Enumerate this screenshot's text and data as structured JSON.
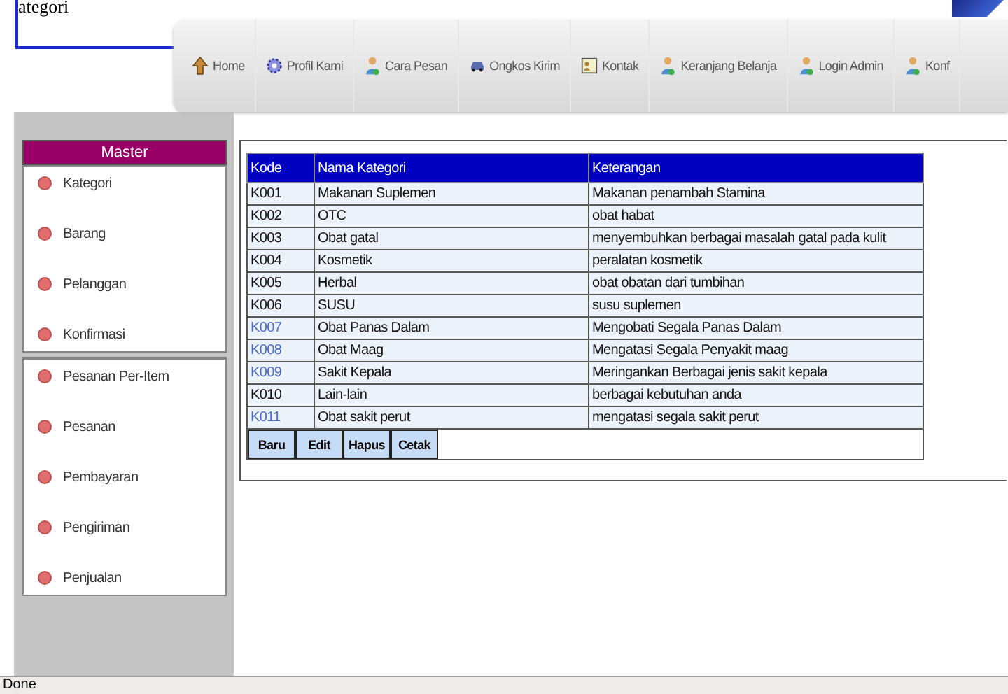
{
  "page_title": "ategori",
  "nav": [
    {
      "label": "Home",
      "kind": "home"
    },
    {
      "label": "Profil Kami",
      "kind": "profile"
    },
    {
      "label": "Cara Pesan",
      "kind": "person"
    },
    {
      "label": "Ongkos Kirim",
      "kind": "shipping"
    },
    {
      "label": "Kontak",
      "kind": "contact"
    },
    {
      "label": "Keranjang Belanja",
      "kind": "person"
    },
    {
      "label": "Login Admin",
      "kind": "person"
    },
    {
      "label": "Konf",
      "kind": "person"
    }
  ],
  "sidebar": {
    "title": "Master",
    "groups": [
      [
        "Kategori",
        "Barang",
        "Pelanggan",
        "Konfirmasi"
      ],
      [
        "Pesanan Per-Item",
        "Pesanan",
        "Pembayaran",
        "Pengiriman",
        "Penjualan"
      ]
    ]
  },
  "table": {
    "columns": [
      "Kode",
      "Nama Kategori",
      "Keterangan"
    ],
    "rows": [
      {
        "cells": [
          "K001",
          "Makanan Suplemen",
          "Makanan penambah Stamina"
        ],
        "visited": false
      },
      {
        "cells": [
          "K002",
          "OTC",
          "obat habat"
        ],
        "visited": false
      },
      {
        "cells": [
          "K003",
          "Obat gatal",
          "menyembuhkan berbagai masalah gatal pada kulit"
        ],
        "visited": false
      },
      {
        "cells": [
          "K004",
          "Kosmetik",
          "peralatan kosmetik"
        ],
        "visited": false
      },
      {
        "cells": [
          "K005",
          "Herbal",
          "obat obatan dari tumbihan"
        ],
        "visited": false
      },
      {
        "cells": [
          "K006",
          "SUSU",
          "susu suplemen"
        ],
        "visited": false
      },
      {
        "cells": [
          "K007",
          "Obat Panas Dalam",
          "Mengobati Segala Panas Dalam"
        ],
        "visited": true
      },
      {
        "cells": [
          "K008",
          "Obat Maag",
          "Mengatasi Segala Penyakit maag"
        ],
        "visited": true
      },
      {
        "cells": [
          "K009",
          "Sakit Kepala",
          "Meringankan Berbagai jenis sakit kepala"
        ],
        "visited": true
      },
      {
        "cells": [
          "K010",
          "Lain-lain",
          "berbagai kebutuhan anda"
        ],
        "visited": false
      },
      {
        "cells": [
          "K011",
          "Obat sakit perut",
          "mengatasi segala sakit perut"
        ],
        "visited": true
      }
    ],
    "buttons": [
      "Baru",
      "Edit",
      "Hapus",
      "Cetak"
    ]
  },
  "status_bar": "Done"
}
